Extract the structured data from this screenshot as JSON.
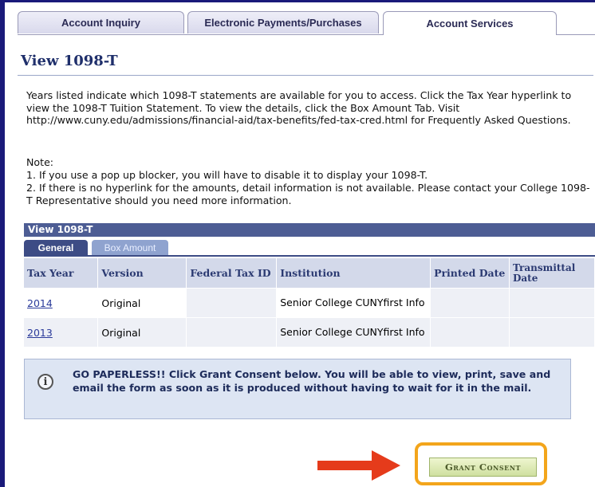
{
  "tabs": [
    {
      "label": "Account Inquiry",
      "active": false
    },
    {
      "label": "Electronic Payments/Purchases",
      "active": false
    },
    {
      "label": "Account Services",
      "active": true
    }
  ],
  "page_title": "View 1098-T",
  "intro": "Years listed indicate which 1098-T statements are available for you to access. Click the Tax Year hyperlink to view the 1098-T Tuition Statement.  To view the details, click the Box Amount Tab.  Visit http://www.cuny.edu/admissions/financial-aid/tax-benefits/fed-tax-cred.html for Frequently Asked Questions.",
  "note": {
    "heading": "Note:",
    "line1": "1. If you use a pop up blocker, you will have to disable it to display your 1098-T.",
    "line2": "2. If there is no hyperlink for the amounts, detail information is not available.  Please contact your College 1098-T Representative should you need more information."
  },
  "grid": {
    "title": "View 1098-T",
    "tabs": {
      "general": "General",
      "box_amount": "Box Amount"
    },
    "columns": {
      "tax_year": "Tax Year",
      "version": "Version",
      "federal_tax_id": "Federal Tax ID",
      "institution": "Institution",
      "printed_date": "Printed Date",
      "transmittal_date": "Transmittal Date"
    },
    "rows": [
      {
        "tax_year": "2014",
        "version": "Original",
        "federal_tax_id": "",
        "institution": "Senior College CUNYfirst Info",
        "printed_date": "",
        "transmittal_date": ""
      },
      {
        "tax_year": "2013",
        "version": "Original",
        "federal_tax_id": "",
        "institution": "Senior College CUNYfirst Info",
        "printed_date": "",
        "transmittal_date": ""
      }
    ]
  },
  "info_box": {
    "icon": "info-icon",
    "text": "GO PAPERLESS!! Click Grant Consent below. You will be able to view, print, save and email the form as soon as it is produced without having to wait for it in the mail."
  },
  "grant_button": {
    "label": "Grant Consent"
  },
  "colors": {
    "header_blue": "#4d5d94",
    "title_blue": "#1f2f6b",
    "highlight_orange": "#f3a51b",
    "arrow_red": "#e53b1b",
    "button_green": "#cfe0a0"
  }
}
